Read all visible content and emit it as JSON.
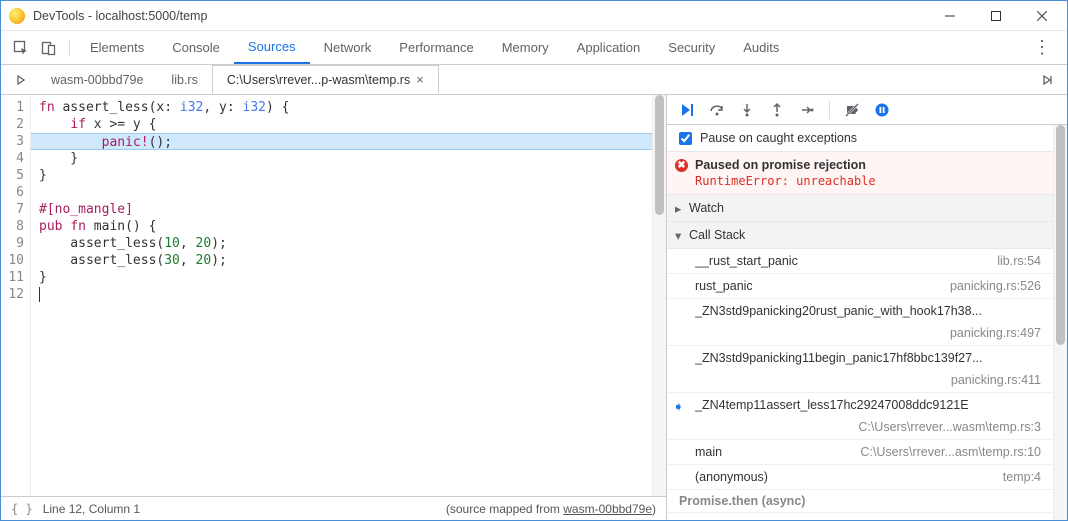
{
  "window": {
    "title": "DevTools - localhost:5000/temp"
  },
  "main_tabs": {
    "items": [
      "Elements",
      "Console",
      "Sources",
      "Network",
      "Performance",
      "Memory",
      "Application",
      "Security",
      "Audits"
    ],
    "active_index": 2
  },
  "sub_tabs": {
    "items": [
      {
        "label": "wasm-00bbd79e",
        "closable": false
      },
      {
        "label": "lib.rs",
        "closable": false
      },
      {
        "label": "C:\\Users\\rrever...p-wasm\\temp.rs",
        "closable": true
      }
    ],
    "active_index": 2
  },
  "code": {
    "highlight_line": 3,
    "lines": [
      "fn assert_less(x: i32, y: i32) {",
      "    if x >= y {",
      "        panic!();",
      "    }",
      "}",
      "",
      "#[no_mangle]",
      "pub fn main() {",
      "    assert_less(10, 20);",
      "    assert_less(30, 20);",
      "}",
      ""
    ]
  },
  "status": {
    "position": "Line 12, Column 1",
    "mapped_prefix": "(source mapped from ",
    "mapped_name": "wasm-00bbd79e",
    "mapped_suffix": ")"
  },
  "debugger": {
    "pause_on_caught_label": "Pause on caught exceptions",
    "pause_on_caught_checked": true,
    "paused_title": "Paused on promise rejection",
    "paused_error": "RuntimeError: unreachable",
    "sections": {
      "watch": "Watch",
      "callstack": "Call Stack"
    },
    "callstack": [
      {
        "name": "__rust_start_panic",
        "loc": "lib.rs:54",
        "current": false,
        "wide": false
      },
      {
        "name": "rust_panic",
        "loc": "panicking.rs:526",
        "current": false,
        "wide": false
      },
      {
        "name": "_ZN3std9panicking20rust_panic_with_hook17h38...",
        "loc": "panicking.rs:497",
        "current": false,
        "wide": true
      },
      {
        "name": "_ZN3std9panicking11begin_panic17hf8bbc139f27...",
        "loc": "panicking.rs:411",
        "current": false,
        "wide": true
      },
      {
        "name": "_ZN4temp11assert_less17hc29247008ddc9121E",
        "loc": "C:\\Users\\rrever...wasm\\temp.rs:3",
        "current": true,
        "wide": true
      },
      {
        "name": "main",
        "loc": "C:\\Users\\rrever...asm\\temp.rs:10",
        "current": false,
        "wide": false
      },
      {
        "name": "(anonymous)",
        "loc": "temp:4",
        "current": false,
        "wide": false
      }
    ],
    "async_label": "Promise.then (async)"
  }
}
